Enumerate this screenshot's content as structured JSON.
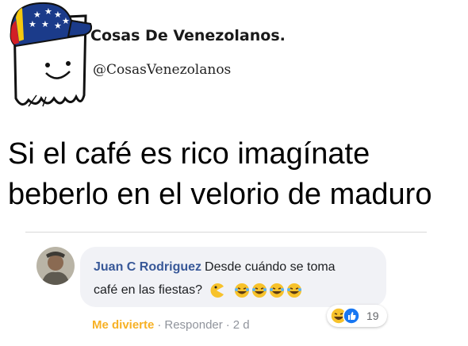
{
  "brand": {
    "name": "Cosas De Venezolanos.",
    "handle": "@CosasVenezolanos"
  },
  "post": {
    "line1": "Si el café es rico imagínate",
    "line2": "beberlo en el velorio de maduro"
  },
  "comment": {
    "author": "Juan C Rodriguez",
    "text_part1": "Desde cuándo se toma",
    "text_part2": "café en las fiestas?",
    "reaction_count": "19",
    "action_reaction": "Me divierte",
    "action_separator": "·",
    "action_reply": "Responder",
    "time": "2 d",
    "emojis": [
      "pacman-emoji-icon",
      "laughing-tears-icon",
      "laughing-tears-icon",
      "laughing-tears-icon",
      "laughing-tears-icon"
    ]
  },
  "colors": {
    "author_link": "#385898",
    "bubble_bg": "#f1f2f6",
    "reaction_active": "#f7b125",
    "meta_text": "#90949c"
  }
}
